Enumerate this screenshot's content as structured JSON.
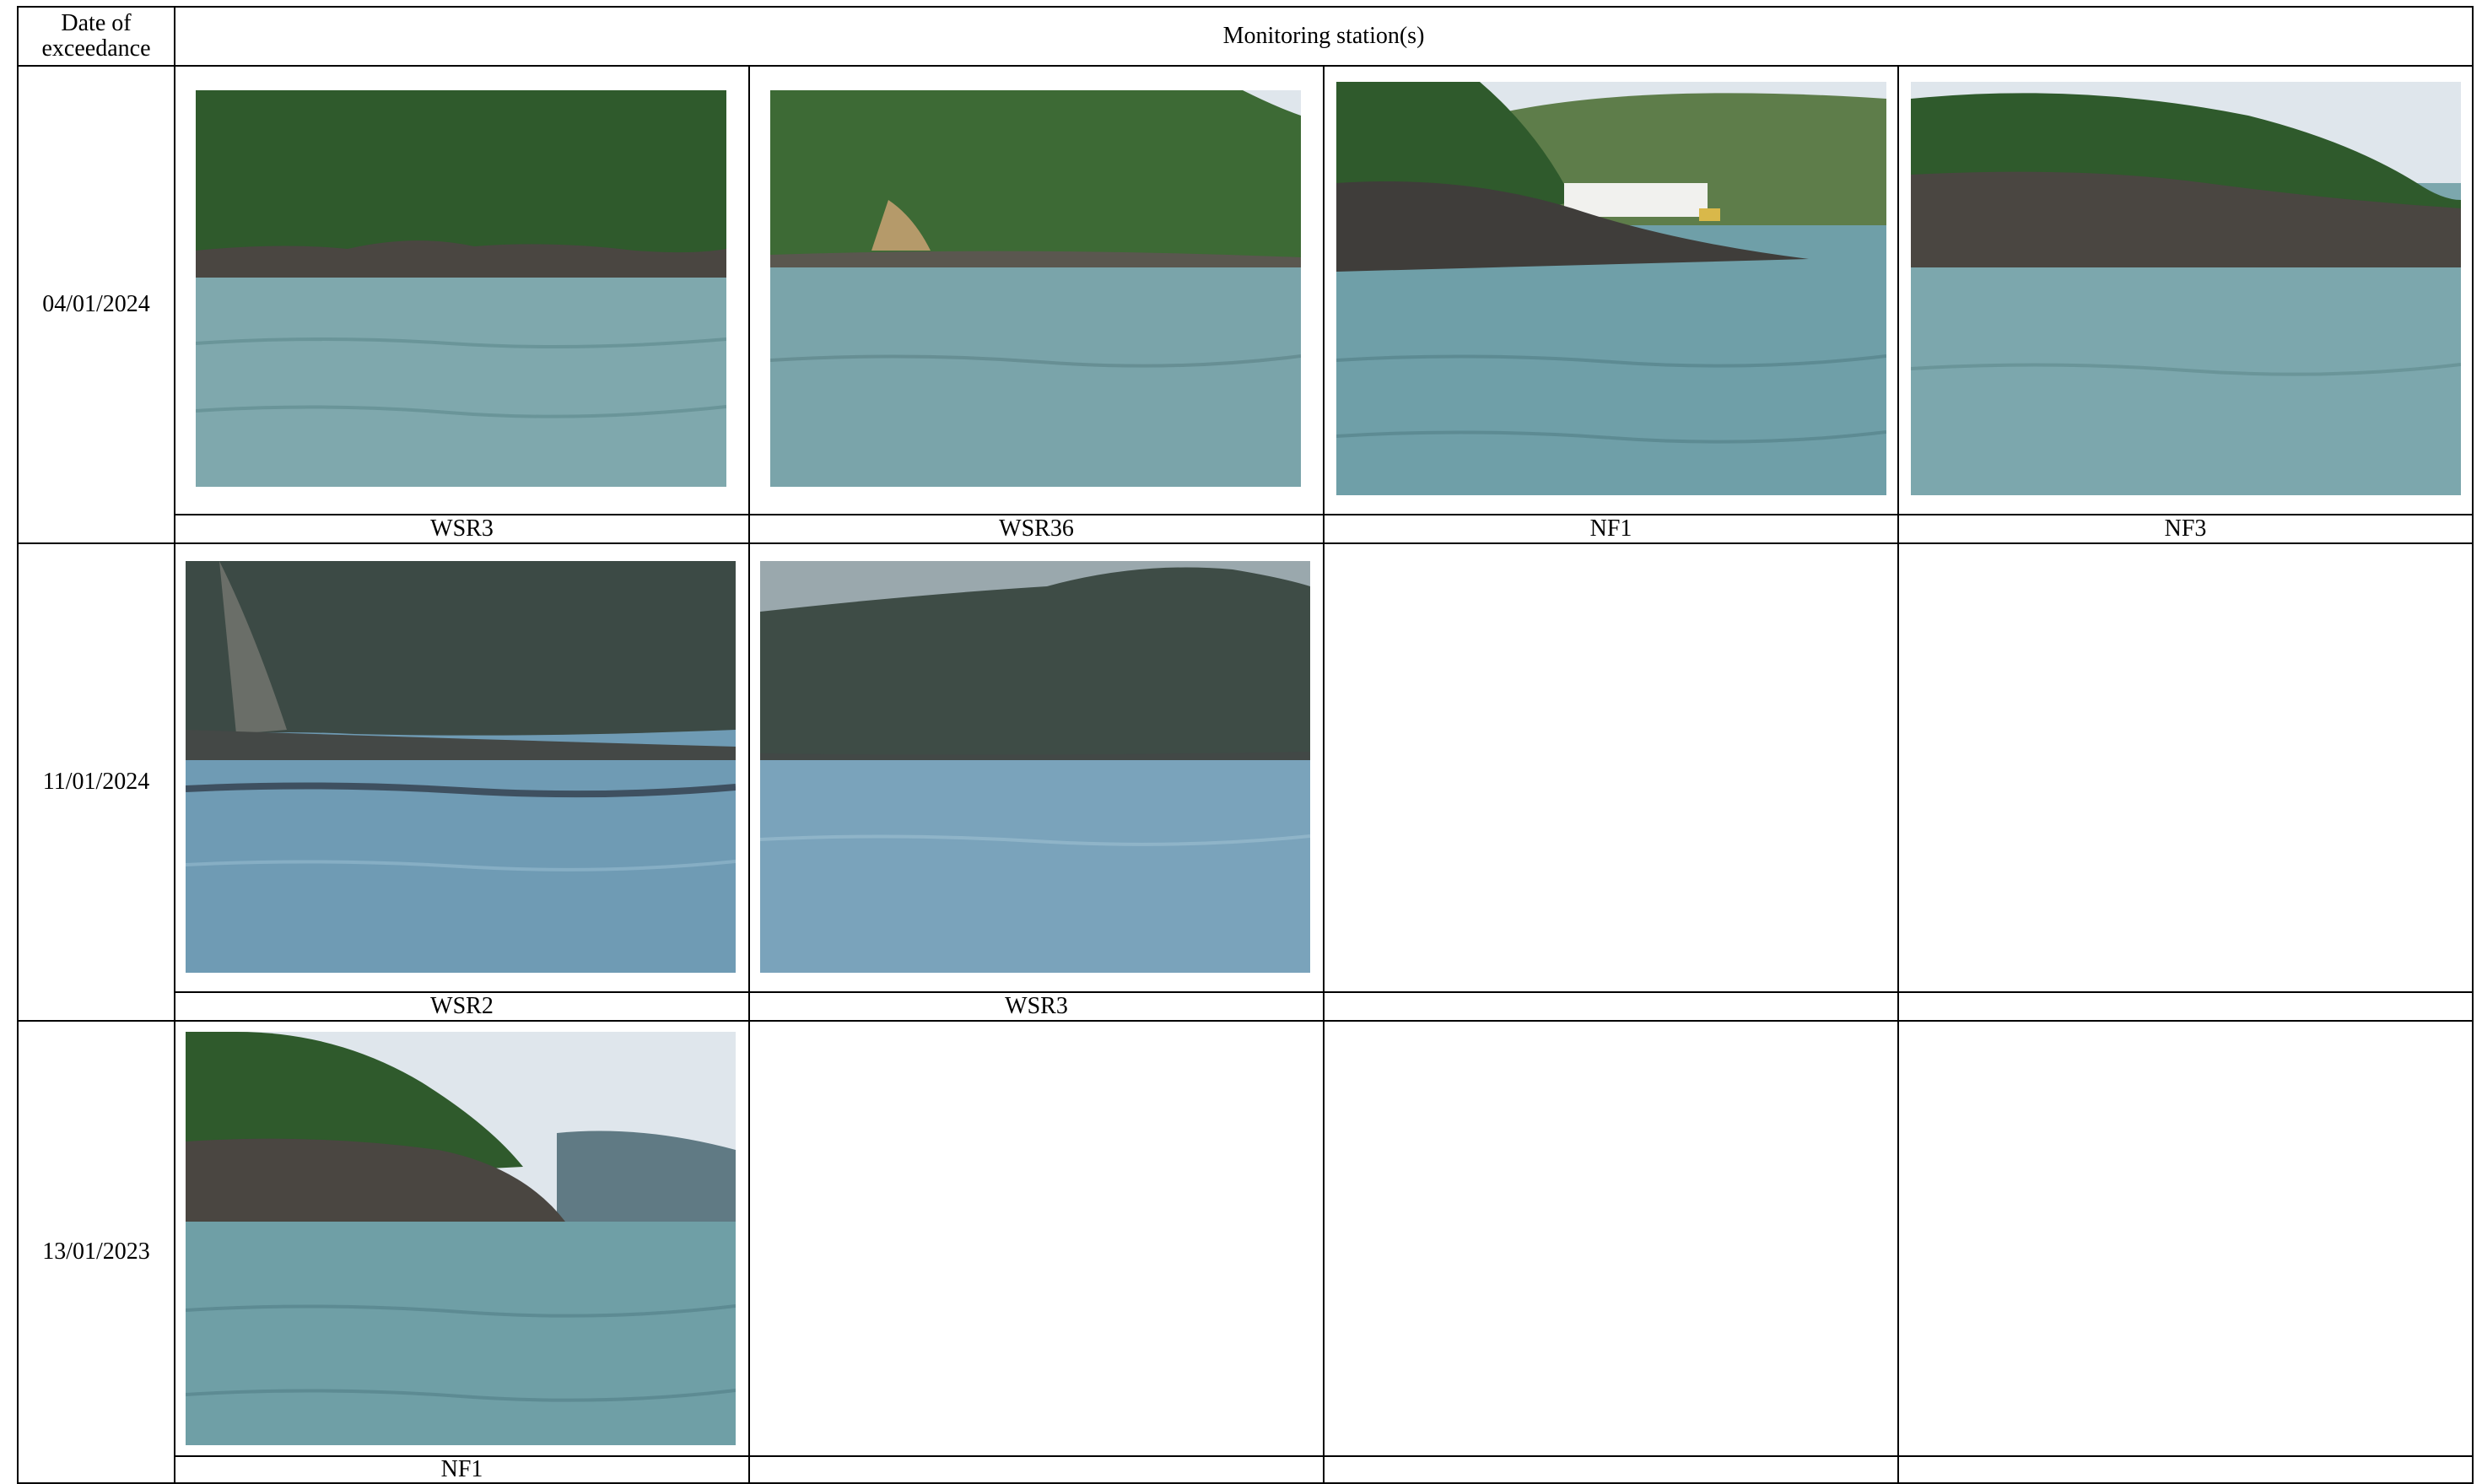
{
  "table": {
    "header": {
      "date_col": "Date of exceedance",
      "stations_col": "Monitoring station(s)"
    },
    "rows": [
      {
        "date": "04/01/2024",
        "stations": [
          "WSR3",
          "WSR36",
          "NF1",
          "NF3"
        ]
      },
      {
        "date": "11/01/2024",
        "stations": [
          "WSR2",
          "WSR3",
          "",
          ""
        ]
      },
      {
        "date": "13/01/2023",
        "stations": [
          "NF1",
          "",
          "",
          ""
        ]
      }
    ]
  },
  "photos": {
    "icon": "sea-coastline-photo",
    "colors": {
      "forest": "#2f5a2c",
      "forest_dim": "#3c4a45",
      "rock": "#4a4641",
      "sea": "#7fa8ad",
      "sea_blue": "#6f9bb4",
      "sky": "#dfe6ec"
    }
  }
}
